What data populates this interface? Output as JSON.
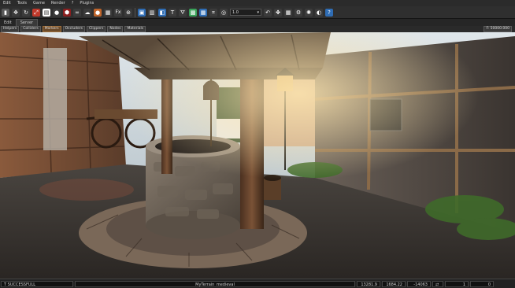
{
  "menu": {
    "items": [
      "Edit",
      "Tools",
      "Game",
      "Render",
      "?",
      "Plugins"
    ]
  },
  "toolbar": {
    "icons": [
      "select-icon",
      "move-icon",
      "rotate-icon",
      "scale-icon",
      "save-icon",
      "undo-icon",
      "redo-icon",
      "link-icon",
      "unlink-icon",
      "terrain-icon",
      "physics-icon",
      "fx-icon",
      "snap-grid-icon",
      "snap-angle-icon",
      "snap-scale-icon",
      "material-icon",
      "text-icon",
      "tag-icon",
      "image-icon",
      "layer-icon",
      "measure-icon",
      "camera-icon"
    ],
    "snap_value": "1.0",
    "right_icons": [
      "undo-arrow-icon",
      "settings-icon",
      "grid-icon",
      "gear-icon",
      "globe-icon",
      "sphere-icon",
      "help-icon"
    ]
  },
  "tabs": {
    "left": "Edit",
    "server": "Server"
  },
  "viewport_header": {
    "filters": [
      "Helpers",
      "Colliders",
      "Markers",
      "Occluders",
      "Clippers",
      "Nodes",
      "Materials"
    ],
    "active_filter": "Markers",
    "camera_speed": "F: 50000.000"
  },
  "status": {
    "message": "T SUCCESSFULL",
    "level": "MyTerrain_medieval",
    "x": "13281.9",
    "y": "1684.22",
    "z": "-14063",
    "speed": "1",
    "value": "0"
  },
  "colors": {
    "accent": "#a0703c",
    "chrome": "#2f2f2f"
  }
}
